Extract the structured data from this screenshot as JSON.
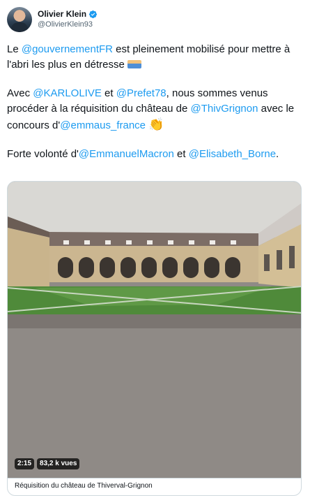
{
  "author": {
    "display_name": "Olivier Klein",
    "handle": "@OlivierKlein93"
  },
  "tweet": {
    "p1": {
      "t1": "Le ",
      "m1": "@gouvernementFR",
      "t2": " est pleinement mobilisé pour mettre à l'abri les plus en détresse "
    },
    "p2": {
      "t1": "Avec ",
      "m1": "@KARLOLIVE",
      "t2": " et ",
      "m2": "@Prefet78",
      "t3": ", nous sommes venus procéder à la réquisition du château de ",
      "m3": "@ThivGrignon",
      "t4": " avec le concours d'",
      "m4": "@emmaus_france",
      "t5": " "
    },
    "p3": {
      "t1": "Forte volonté d'",
      "m1": "@EmmanuelMacron",
      "t2": " et ",
      "m2": "@Elisabeth_Borne",
      "t3": "."
    }
  },
  "media": {
    "duration": "2:15",
    "views": "83,2 k vues",
    "caption": "Réquisition du château de Thiverval-Grignon"
  },
  "colors": {
    "mention": "#1d9bf0",
    "text": "#0f1419",
    "muted": "#536471",
    "verified": "#1d9bf0",
    "border": "#cfd9de"
  },
  "icons": {
    "verified": "verified-badge-icon",
    "bed_emoji": "bed-emoji-icon",
    "clap_emoji": "clapping-hands-emoji-icon"
  }
}
